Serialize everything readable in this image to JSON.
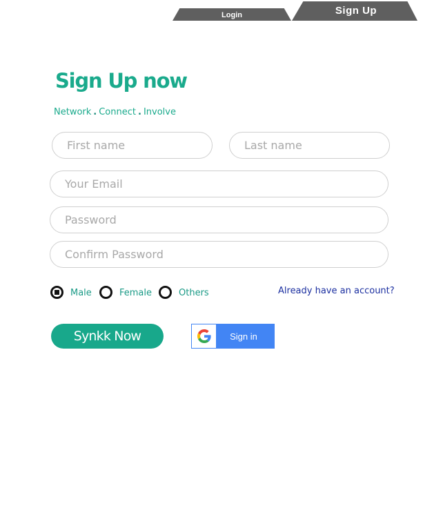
{
  "tabs": {
    "login": "Login",
    "signup": "Sign Up"
  },
  "heading": {
    "title": "Sign Up now",
    "tagline": [
      "Network",
      "Connect",
      "Involve"
    ]
  },
  "form": {
    "first_name_placeholder": "First name",
    "last_name_placeholder": "Last name",
    "email_placeholder": "Your Email",
    "password_placeholder": "Password",
    "confirm_password_placeholder": "Confirm Password",
    "gender": {
      "options": [
        "Male",
        "Female",
        "Others"
      ],
      "selected": "Male"
    },
    "already_account_link": "Already have an account?"
  },
  "buttons": {
    "synkk": "Synkk Now",
    "google_sign_in": "Sign in"
  },
  "colors": {
    "accent": "#18a88b",
    "tab": "#5f5f5f",
    "google_blue": "#4285f4",
    "link": "#1b2fa0"
  }
}
